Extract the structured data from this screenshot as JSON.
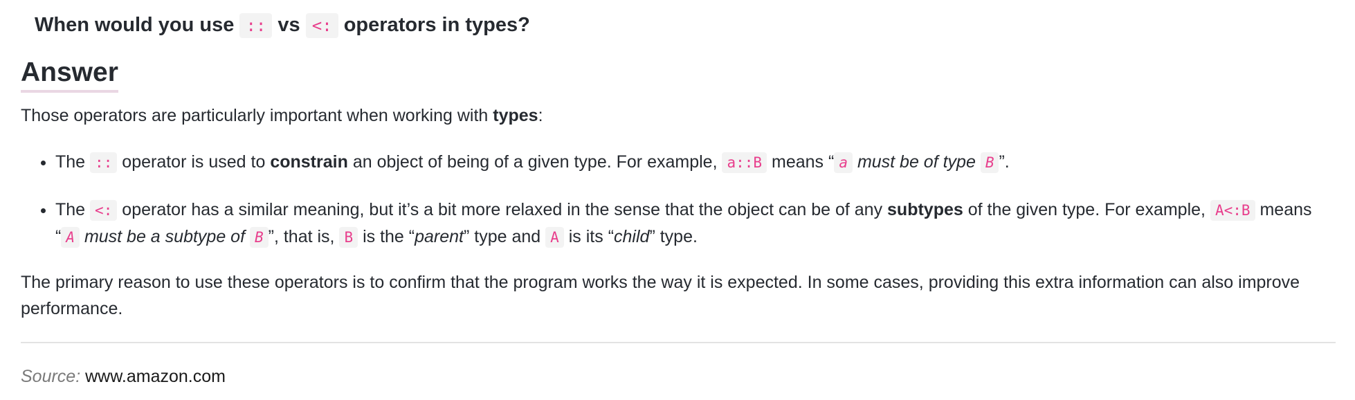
{
  "question": {
    "prefix": "When would you use",
    "op1": "::",
    "middle": "vs",
    "op2": "<:",
    "suffix": "operators in types?"
  },
  "answer_heading": "Answer",
  "intro": {
    "text": "Those operators are particularly important when working with",
    "bold": "types",
    "end": ":"
  },
  "bullets": [
    {
      "the": "The",
      "op": "::",
      "t1": "operator is used to",
      "bold": "constrain",
      "t2": "an object of being of a given type. For example,",
      "example": "a::B",
      "t3": "means “",
      "code_a": "a",
      "italic": "must be of type",
      "code_b": "B",
      "t4": "”."
    },
    {
      "the": "The",
      "op": "<:",
      "t1": "operator has a similar meaning, but it’s a bit more relaxed in the sense that the object can be of any",
      "bold": "subtypes",
      "t2": "of the given type. For example,",
      "example": "A<:B",
      "t3": "means “",
      "code_a": "A",
      "italic": "must be a subtype of",
      "code_b": "B",
      "t4": "”, that is,",
      "code_c": "B",
      "t5": "is the “",
      "italic_parent": "parent",
      "t6": "” type and",
      "code_d": "A",
      "t7": "is its “",
      "italic_child": "child",
      "t8": "” type."
    }
  ],
  "conclusion": "The primary reason to use these operators is to confirm that the program works the way it is expected. In some cases, providing this extra information can also improve performance.",
  "source": {
    "label": "Source:",
    "value": "www.amazon.com"
  },
  "colors": {
    "code_text": "#e83e8c",
    "code_bg": "#f3f3f3",
    "body_text": "#262a30",
    "heading_underline": "#ead7e3"
  }
}
